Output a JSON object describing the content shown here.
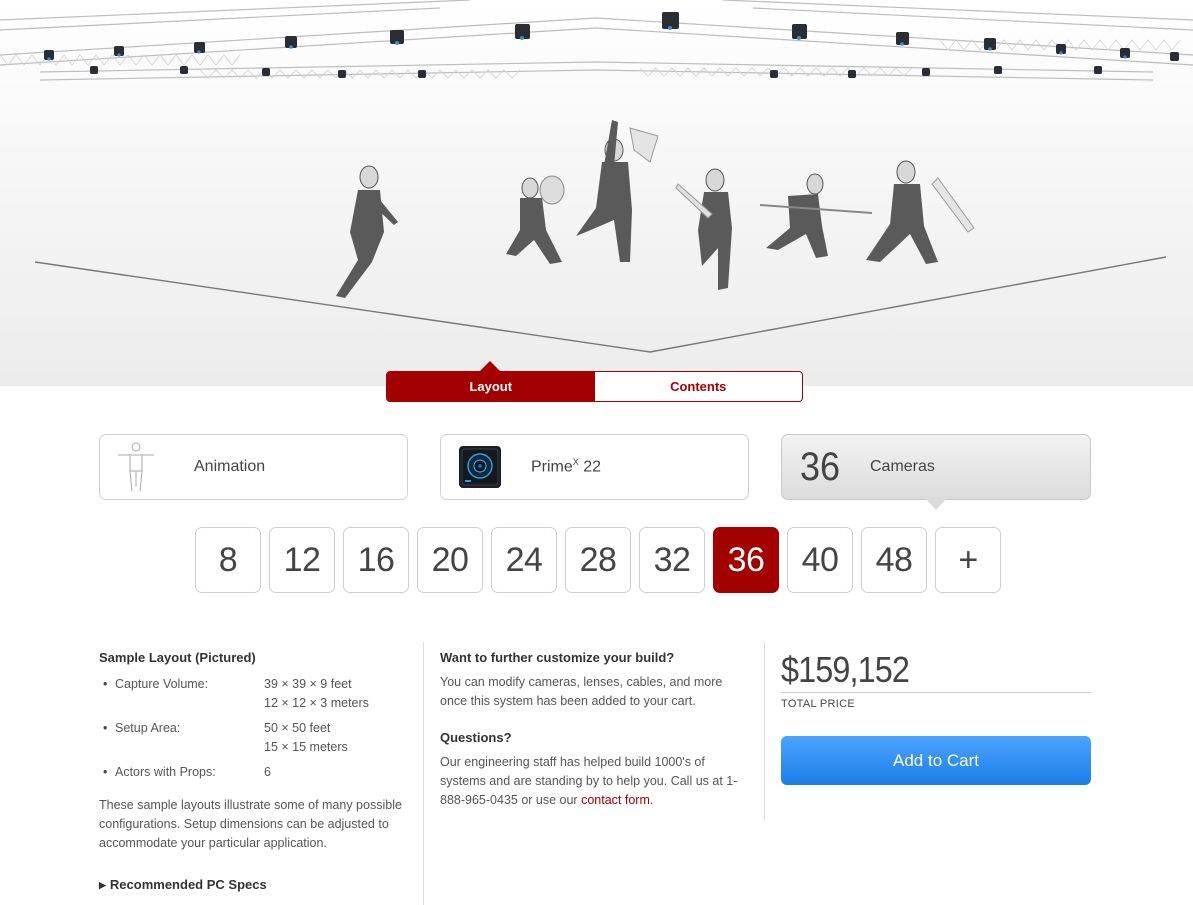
{
  "hero": {
    "image": "motion-capture-stage"
  },
  "toggle": {
    "layout_label": "Layout",
    "contents_label": "Contents"
  },
  "cards": {
    "application": {
      "label": "Animation",
      "icon": "human-figure-icon"
    },
    "camera": {
      "label_main": "Prime",
      "label_sup": "X",
      "label_model": " 22",
      "icon": "primex22-camera-icon"
    },
    "count": {
      "value": "36",
      "label": "Cameras"
    }
  },
  "camera_counts": [
    "8",
    "12",
    "16",
    "20",
    "24",
    "28",
    "32",
    "36",
    "40",
    "48",
    "+"
  ],
  "selected_count": "36",
  "sample_layout": {
    "title": "Sample Layout (Pictured)",
    "specs": [
      {
        "key": "Capture Volume:",
        "val1": "39 × 39 × 9 feet",
        "val2": "12 × 12 × 3 meters"
      },
      {
        "key": "Setup Area:",
        "val1": "50 × 50 feet",
        "val2": "15 × 15 meters"
      },
      {
        "key": "Actors with Props:",
        "val1": "6",
        "val2": ""
      }
    ],
    "note": "These sample layouts illustrate some of many possible configurations. Setup dimensions can be adjusted to accommodate your particular application.",
    "pc_specs_label": "Recommended PC Specs"
  },
  "customize": {
    "title": "Want to further customize your build?",
    "text": "You can modify cameras, lenses, cables, and more once this system has been added to your cart.",
    "questions_title": "Questions?",
    "questions_text": "Our engineering staff has helped build 1000's of systems and are standing by to help you. Call us at 1-888-965-0435 or use our ",
    "contact_link": "contact form",
    "questions_end": "."
  },
  "pricing": {
    "price": "$159,152",
    "label": "TOTAL PRICE",
    "cart_button": "Add to Cart"
  },
  "colors": {
    "accent": "#a30000",
    "button_blue": "#2b8cf3"
  }
}
